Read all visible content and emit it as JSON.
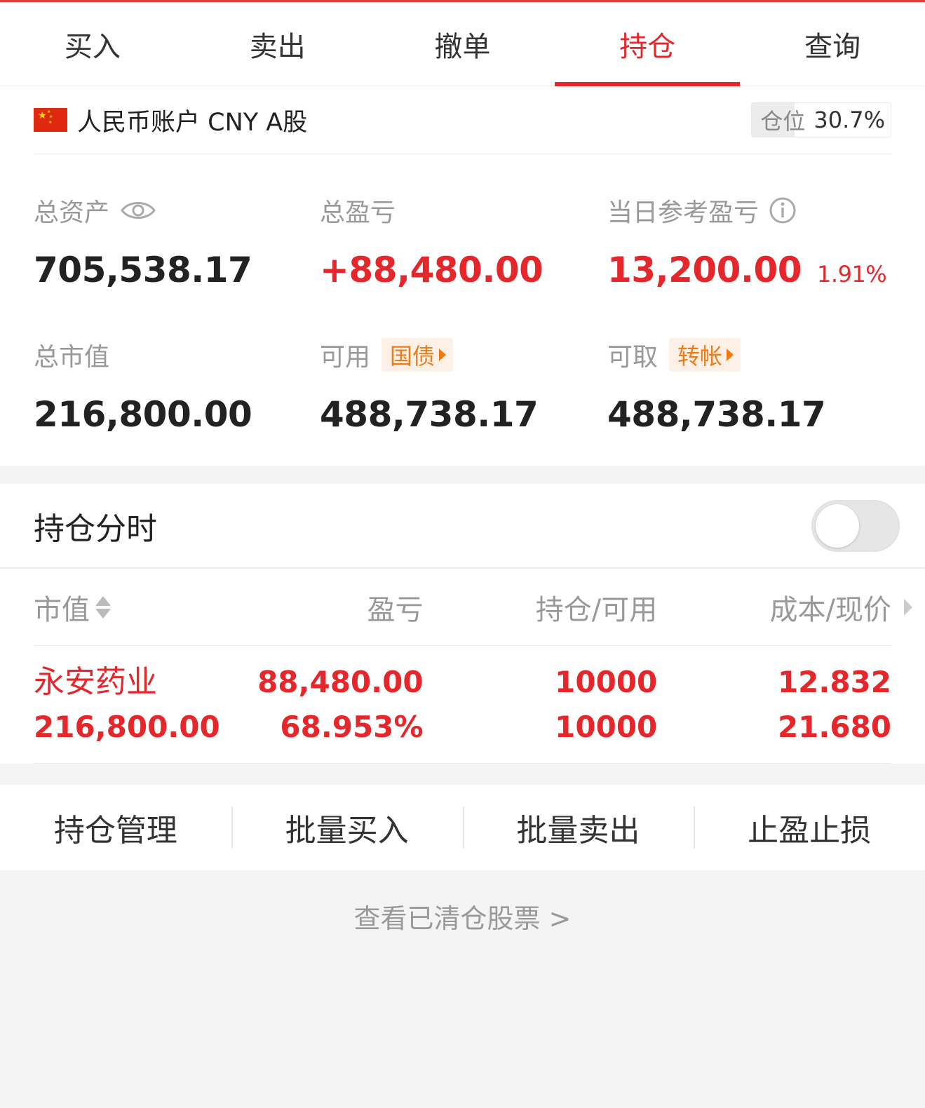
{
  "tabs": [
    {
      "label": "买入"
    },
    {
      "label": "卖出"
    },
    {
      "label": "撤单"
    },
    {
      "label": "持仓",
      "active": true
    },
    {
      "label": "查询"
    }
  ],
  "account": {
    "name": "人民币账户 CNY A股",
    "position_label": "仓位",
    "position_value": "30.7%"
  },
  "summary": {
    "total_assets_label": "总资产",
    "total_assets": "705,538.17",
    "total_pnl_label": "总盈亏",
    "total_pnl": "+88,480.00",
    "daily_pnl_label": "当日参考盈亏",
    "daily_pnl": "13,200.00",
    "daily_pnl_pct": "1.91%",
    "market_value_label": "总市值",
    "market_value": "216,800.00",
    "available_label": "可用",
    "available_tag": "国债",
    "available": "488,738.17",
    "withdrawable_label": "可取",
    "withdrawable_tag": "转帐",
    "withdrawable": "488,738.17"
  },
  "holdings": {
    "title": "持仓分时",
    "toggle_on": false,
    "columns": [
      "市值",
      "盈亏",
      "持仓/可用",
      "成本/现价"
    ],
    "rows": [
      {
        "name": "永安药业",
        "market_value": "216,800.00",
        "pnl": "88,480.00",
        "pnl_pct": "68.953%",
        "position": "10000",
        "available": "10000",
        "cost": "12.832",
        "price": "21.680"
      }
    ]
  },
  "actions": [
    "持仓管理",
    "批量买入",
    "批量卖出",
    "止盈止损"
  ],
  "cleared_link": "查看已清仓股票 >",
  "colors": {
    "accent_red": "#e5262b",
    "tag_orange": "#f07a14"
  }
}
